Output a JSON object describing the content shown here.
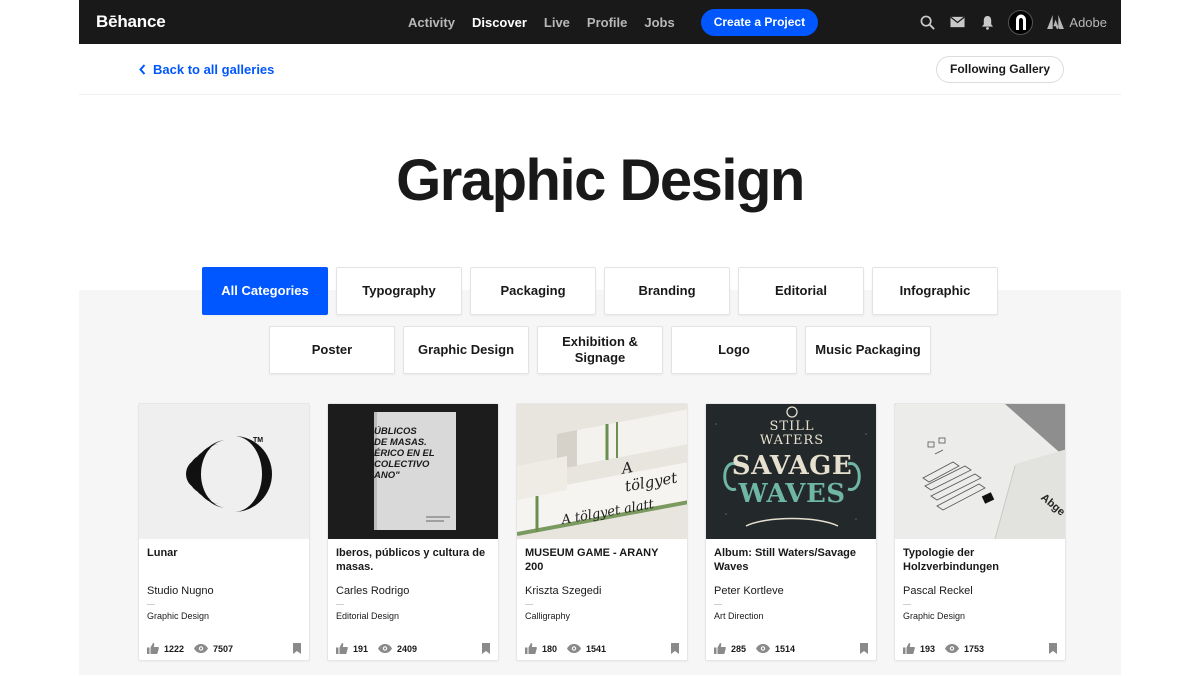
{
  "nav": {
    "logo": "Bēhance",
    "links": [
      "Activity",
      "Discover",
      "Live",
      "Profile",
      "Jobs"
    ],
    "active_link": "Discover",
    "create_label": "Create a Project",
    "adobe_label": "Adobe",
    "icons": [
      "search-icon",
      "mail-icon",
      "bell-icon"
    ]
  },
  "header": {
    "back_label": "Back to all galleries",
    "follow_label": "Following Gallery",
    "title": "Graphic Design"
  },
  "categories": {
    "row1": [
      "All Categories",
      "Typography",
      "Packaging",
      "Branding",
      "Editorial",
      "Infographic"
    ],
    "row2": [
      "Poster",
      "Graphic Design",
      "Exhibition & Signage",
      "Logo",
      "Music Packaging"
    ],
    "active": "All Categories"
  },
  "projects": [
    {
      "title": "Lunar",
      "owner": "Studio Nugno",
      "field": "Graphic Design",
      "likes": "1222",
      "views": "7507",
      "thumb": "lunar"
    },
    {
      "title": "Iberos, públicos y cultura de masas.",
      "owner": "Carles Rodrigo",
      "field": "Editorial Design",
      "likes": "191",
      "views": "2409",
      "thumb": "book",
      "thumb_text": [
        "ÚBLICOS",
        "DE MASAS.",
        "ÉRICO EN EL",
        "COLECTIVO",
        "ANO\""
      ]
    },
    {
      "title": "MUSEUM GAME - ARANY 200",
      "owner": "Kriszta Szegedi",
      "field": "Calligraphy",
      "likes": "180",
      "views": "1541",
      "thumb": "calligraphy",
      "thumb_text": [
        "A tölgyet",
        "A tölgyet alatt"
      ]
    },
    {
      "title": "Album: Still Waters/Savage Waves",
      "owner": "Peter Kortleve",
      "field": "Art Direction",
      "likes": "285",
      "views": "1514",
      "thumb": "album",
      "thumb_text": [
        "STILL",
        "WATERS",
        "SAVAGE",
        "WAVES"
      ]
    },
    {
      "title": "Typologie der Holzverbindungen",
      "owner": "Pascal Reckel",
      "field": "Graphic Design",
      "likes": "193",
      "views": "1753",
      "thumb": "typologie",
      "thumb_text": [
        "Abge"
      ]
    }
  ]
}
